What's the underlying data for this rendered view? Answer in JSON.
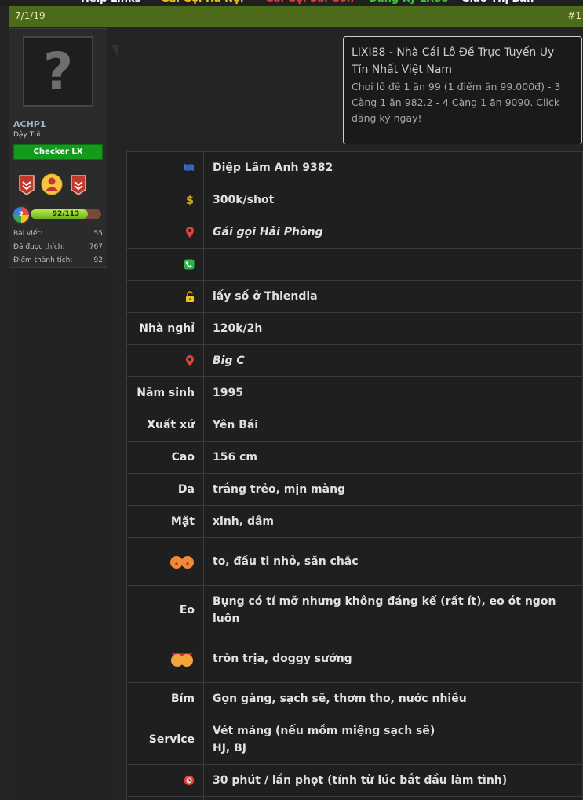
{
  "post": {
    "date": "7/1/19",
    "number": "#1"
  },
  "user": {
    "name": "ACHP1",
    "title": "Dậy Thì",
    "group_button": "Checker LX",
    "level": "2",
    "xp_text": "92/113",
    "xp_fraction": 0.814,
    "stats": [
      {
        "label": "Bài viết:",
        "value": "55"
      },
      {
        "label": "Đã được thích:",
        "value": "767"
      },
      {
        "label": "Điểm thành tích:",
        "value": "92"
      }
    ]
  },
  "ad": {
    "title": "LIXI88 - Nhà Cái Lô Đề Trực Tuyến Uy Tín Nhất Việt Nam",
    "description": "Chơi lô đề 1 ăn 99 (1 điểm ăn 99.000đ) - 3 Càng 1 ăn 982.2 - 4 Càng 1 ăn 9090. Click đăng ký ngay!"
  },
  "rows": [
    {
      "label": "",
      "icon": "flag-icon",
      "value": "Diệp Lâm Anh 9382"
    },
    {
      "label": "",
      "icon": "dollar-icon",
      "value": "300k/shot"
    },
    {
      "label": "",
      "icon": "map-pin-icon",
      "value": "Gái gọi Hải Phòng"
    },
    {
      "label": "",
      "icon": "phone-icon",
      "value": ""
    },
    {
      "label": "",
      "icon": "unlock-icon",
      "value": "lấy số ở Thiendia"
    },
    {
      "label": "Nhà nghỉ",
      "value": "120k/2h"
    },
    {
      "label": "",
      "icon": "map-pin-icon",
      "value": "Big C"
    },
    {
      "label": "Năm sinh",
      "value": "1995"
    },
    {
      "label": "Xuất xứ",
      "value": "Yên Bái"
    },
    {
      "label": "Cao",
      "value": "156 cm"
    },
    {
      "label": "Da",
      "value": "trắng trẻo, mịn màng"
    },
    {
      "label": "Mặt",
      "value": "xinh, dâm"
    },
    {
      "label": "",
      "icon": "bust-icon",
      "value": "to, đầu ti nhỏ, săn chắc"
    },
    {
      "label": "Eo",
      "value": "Bụng có tí mỡ nhưng không đáng kể (rất ít), eo ót ngon luôn"
    },
    {
      "label": "",
      "icon": "butt-icon",
      "value": "tròn trịa, doggy sướng"
    },
    {
      "label": "Bím",
      "value": "Gọn gàng, sạch sẽ, thơm tho, nước nhiều"
    },
    {
      "label": "Service",
      "value_lines": [
        "Vét máng (nếu mồm miệng sạch sẽ)",
        "HJ, BJ"
      ]
    },
    {
      "label": "",
      "icon": "timer-icon",
      "value": "30 phút / lần phọt (tính từ lúc bắt đầu làm tình)"
    }
  ]
}
